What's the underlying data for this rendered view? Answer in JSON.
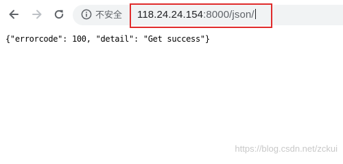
{
  "browser": {
    "security_label": "不安全",
    "url_host": "118.24.24.154",
    "url_rest": ":8000/json/",
    "icons": {
      "back": "back-arrow-icon",
      "forward": "forward-arrow-icon",
      "reload": "reload-icon",
      "info": "info-icon"
    }
  },
  "page": {
    "body_text": "{\"errorcode\": 100, \"detail\": \"Get success\"}"
  },
  "watermark": {
    "text": "https://blog.csdn.net/zckui"
  },
  "colors": {
    "highlight": "#e02a2a"
  }
}
